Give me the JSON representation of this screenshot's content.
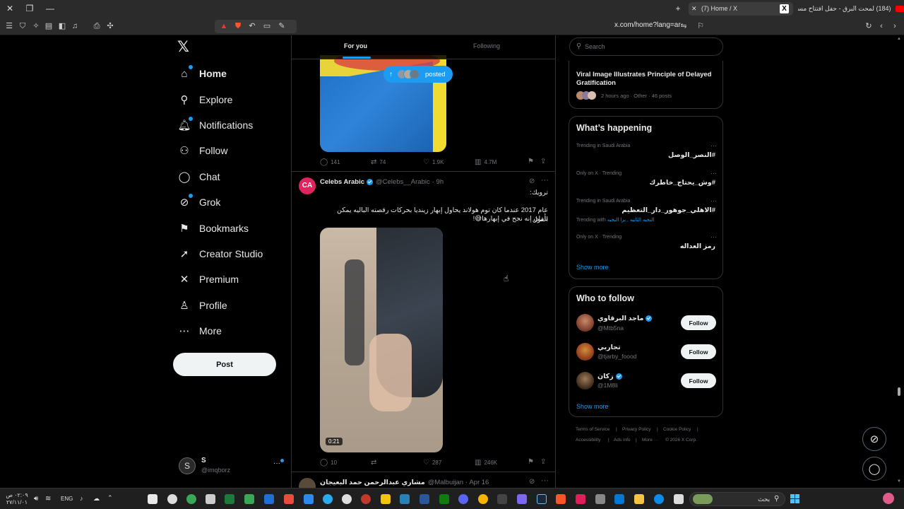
{
  "browser": {
    "tabs": [
      {
        "title": "(7) Home / X",
        "active": true
      },
      {
        "title": "(184) لمحت البرق - حفل افتتاح مسرح ا...",
        "active": false
      }
    ],
    "new_tab_symbol": "+",
    "url": "x.com/home?lang=ar"
  },
  "sidebar": {
    "logo": "x-logo",
    "items": [
      {
        "label": "Home",
        "icon": "home-icon",
        "active": true,
        "dot": true
      },
      {
        "label": "Explore",
        "icon": "search-icon",
        "dot": false
      },
      {
        "label": "Notifications",
        "icon": "bell-icon",
        "dot": true
      },
      {
        "label": "Follow",
        "icon": "person-plus-icon",
        "dot": false
      },
      {
        "label": "Chat",
        "icon": "chat-icon",
        "dot": false
      },
      {
        "label": "Grok",
        "icon": "grok-icon",
        "dot": true
      },
      {
        "label": "Bookmarks",
        "icon": "bookmark-icon",
        "dot": false
      },
      {
        "label": "Creator Studio",
        "icon": "rocket-icon",
        "dot": false
      },
      {
        "label": "Premium",
        "icon": "x-icon",
        "dot": false
      },
      {
        "label": "Profile",
        "icon": "person-icon",
        "dot": false
      },
      {
        "label": "More",
        "icon": "more-circle-icon",
        "dot": false
      }
    ],
    "post_label": "Post",
    "account": {
      "name": "S",
      "handle": "@imqborz",
      "more": "···"
    }
  },
  "timeline": {
    "tabs": [
      {
        "label": "For you",
        "active": true
      },
      {
        "label": "Following",
        "active": false
      }
    ],
    "posted_pill": "posted",
    "tweet1_actions": {
      "replies": "141",
      "reposts": "74",
      "likes": "1.9K",
      "views": "4.7M"
    },
    "tweet2": {
      "author": "Celebs Arabic",
      "handle": "@Celebs__Arabic",
      "time": "· 9h",
      "text_line1": "ترويك:",
      "text_line2": "عام 2017 عندما كان توم هولاند يحاول إبهار زينديا بحركات رقصته الباليه يمكن القول",
      "text_line3": "بأمان إنه نجح في إبهارها😅!",
      "video_duration": "0:21",
      "actions": {
        "replies": "10",
        "reposts": "",
        "likes": "287",
        "views": "246K"
      }
    },
    "tweet3": {
      "author": "مشاري عبدالرحمن حمد البعيجان",
      "handle": "@Malbuijan",
      "time": "· Apr 16"
    }
  },
  "right": {
    "search_placeholder": "Search",
    "news": {
      "title": "Viral Image Illustrates Principle of Delayed Gratification",
      "meta": "2 hours ago · Other · 46 posts"
    },
    "happening": {
      "heading": "What’s happening",
      "trends": [
        {
          "meta": "Trending in Saudi Arabia",
          "name": "#النصر_الوصل",
          "extra": ""
        },
        {
          "meta": "Only on X · Trending",
          "name": "#وش_يحتاج_خاطرك",
          "extra": ""
        },
        {
          "meta": "Trending in Saudi Arabia",
          "name": "#الاهلي_جوهور_دار_التعظيم",
          "extra_prefix": "Trending with",
          "extra": "النخبه الثانيه , برا النخبه"
        },
        {
          "meta": "Only on X · Trending",
          "name": "رمز العداله",
          "extra": ""
        }
      ],
      "show_more": "Show more"
    },
    "who_to_follow": {
      "heading": "Who to follow",
      "users": [
        {
          "name": "ماجد البرقاوي",
          "handle": "@Mtb5na",
          "verified": true,
          "button": "Follow"
        },
        {
          "name": "تجاربي",
          "handle": "@tjarby_foood",
          "verified": false,
          "button": "Follow"
        },
        {
          "name": "زكان",
          "handle": "@1M8li",
          "verified": true,
          "button": "Follow"
        }
      ],
      "show_more": "Show more"
    },
    "footer": [
      "Terms of Service",
      "|",
      "Privacy Policy",
      "|",
      "Cookie Policy",
      "|",
      "Accessibility",
      "|",
      "Ads info",
      "|",
      "More ···",
      "© 2026 X Corp."
    ]
  },
  "taskbar": {
    "lang": "ENG",
    "time": "٠٢:٠٩ ص",
    "date": "٢٧/١١/٠١",
    "search_placeholder": "بحث"
  },
  "colors": {
    "accent": "#1d9bf0",
    "bg": "#000000",
    "border": "#2f3336",
    "muted": "#71767b",
    "text": "#e7e9ea"
  }
}
